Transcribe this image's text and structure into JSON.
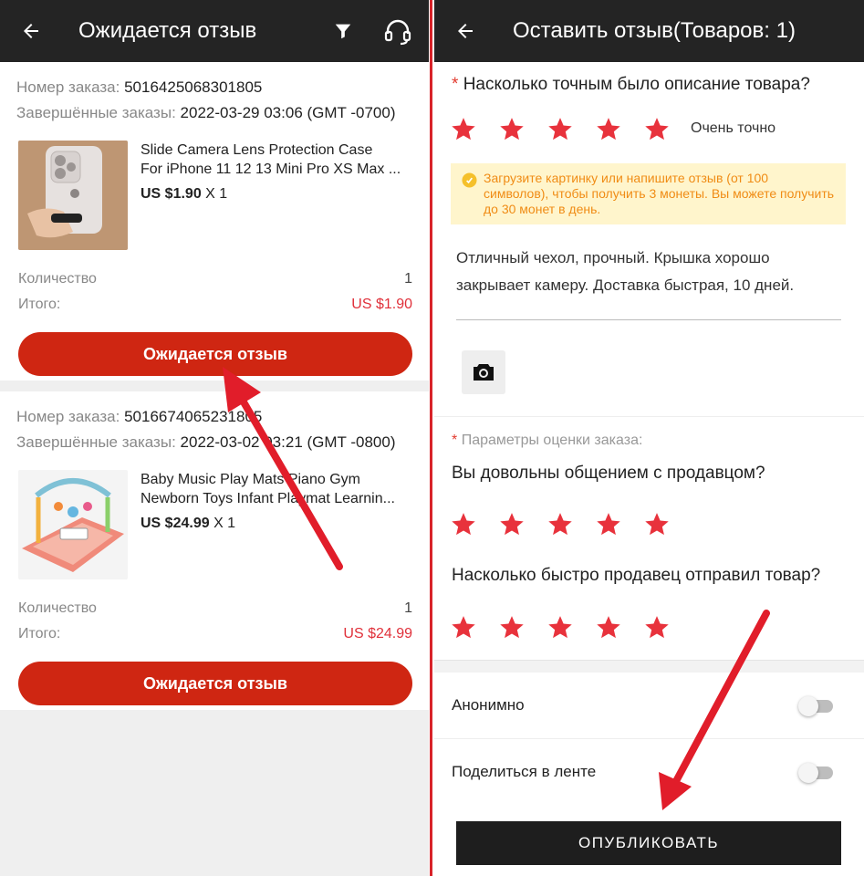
{
  "left": {
    "title": "Ожидается отзыв",
    "icons": {
      "back": "back-arrow-icon",
      "filter": "filter-icon",
      "support": "headset-icon"
    },
    "orders": [
      {
        "order_label": "Номер заказа:",
        "order_number": "5016425068301805",
        "done_label": "Завершённые заказы:",
        "done_date": "2022-03-29 03:06 (GMT -0700)",
        "product_name_1": "Slide Camera Lens Protection Case",
        "product_name_2": "For iPhone 11 12 13 Mini Pro XS Max ...",
        "price": "US $1.90",
        "qty_mult": "X 1",
        "qty_label": "Количество",
        "qty_value": "1",
        "total_label": "Итого:",
        "total_value": "US $1.90",
        "button": "Ожидается отзыв"
      },
      {
        "order_label": "Номер заказа:",
        "order_number": "5016674065231805",
        "done_label": "Завершённые заказы:",
        "done_date": "2022-03-02 03:21 (GMT -0800)",
        "product_name_1": "Baby Music Play Mats Piano Gym",
        "product_name_2": "Newborn Toys Infant Playmat Learnin...",
        "price": "US $24.99",
        "qty_mult": "X 1",
        "qty_label": "Количество",
        "qty_value": "1",
        "total_label": "Итого:",
        "total_value": "US $24.99",
        "button": "Ожидается отзыв"
      }
    ]
  },
  "right": {
    "title": "Оставить отзыв(Товаров: 1)",
    "q1": "Насколько точным было описание товара?",
    "q1_rating": 5,
    "q1_rating_text": "Очень точно",
    "notice": "Загрузите картинку или напишите отзыв (от 100 символов), чтобы получить 3 монеты. Вы можете получить до 30 монет в день.",
    "review_text": "Отличный чехол, прочный. Крышка хорошо закрывает камеру. Доставка быстрая, 10 дней.",
    "params_label": "Параметры оценки заказа:",
    "q2": "Вы довольны общением с продавцом?",
    "q2_rating": 5,
    "q3": "Насколько быстро продавец отправил товар?",
    "q3_rating": 5,
    "anon_label": "Анонимно",
    "anon_on": false,
    "share_label": "Поделиться в ленте",
    "share_on": false,
    "publish": "ОПУБЛИКОВАТЬ"
  },
  "colors": {
    "accent_red": "#cf2612",
    "star_red": "#e8323c",
    "price_red": "#e0303a",
    "appbar": "#242424",
    "arrow_red": "#e11d2a"
  }
}
